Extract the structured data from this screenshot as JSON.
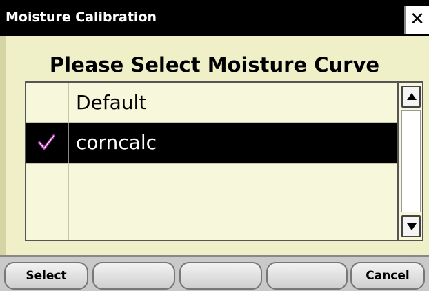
{
  "window": {
    "title": "Moisture Calibration",
    "close_glyph": "✕"
  },
  "dialog": {
    "heading": "Please Select Moisture Curve"
  },
  "curve_list": {
    "items": [
      {
        "label": "Default",
        "checked": false,
        "selected": false
      },
      {
        "label": "corncalc",
        "checked": true,
        "selected": true
      },
      {
        "label": "",
        "checked": false,
        "selected": false
      },
      {
        "label": "",
        "checked": false,
        "selected": false
      }
    ],
    "check_icon": "checkmark-icon",
    "check_color": "#b03cb0"
  },
  "scrollbar": {
    "up_icon": "arrow-up-icon",
    "down_icon": "arrow-down-icon"
  },
  "softkeys": {
    "items": [
      {
        "label": "Select"
      },
      {
        "label": ""
      },
      {
        "label": ""
      },
      {
        "label": ""
      },
      {
        "label": "Cancel"
      }
    ]
  },
  "colors": {
    "background": "#f0f0c8",
    "titlebar": "#000000",
    "selection": "#000000"
  }
}
